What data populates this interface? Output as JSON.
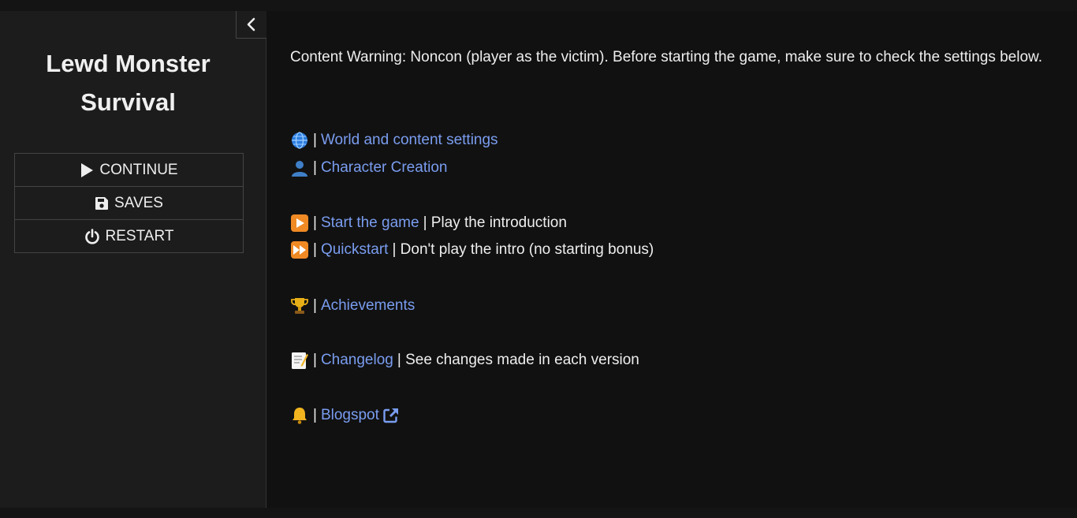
{
  "sidebar": {
    "title": "Lewd Monster Survival",
    "menu": [
      {
        "label": "CONTINUE",
        "icon": "play-icon"
      },
      {
        "label": "SAVES",
        "icon": "floppy-disk-icon"
      },
      {
        "label": "RESTART",
        "icon": "power-icon"
      }
    ],
    "stow_icon": "chevron-left-icon"
  },
  "passage": {
    "warning": "Content Warning: Noncon (player as the victim). Before starting the game, make sure to check the settings below.",
    "separator": "|",
    "links": {
      "world": {
        "icon": "globe-emoji-icon",
        "label": "World and content settings"
      },
      "character": {
        "icon": "bust-silhouette-emoji-icon",
        "label": "Character Creation"
      },
      "start": {
        "icon": "play-button-emoji-icon",
        "label": "Start the game",
        "desc": "| Play the introduction"
      },
      "quick": {
        "icon": "fast-forward-emoji-icon",
        "label": "Quickstart",
        "desc": "| Don't play the intro (no starting bonus)"
      },
      "achievements": {
        "icon": "trophy-emoji-icon",
        "label": "Achievements"
      },
      "changelog": {
        "icon": "memo-emoji-icon",
        "label": "Changelog",
        "desc": "| See changes made in each version"
      },
      "blogspot": {
        "icon": "bell-emoji-icon",
        "label": "Blogspot",
        "extra_icon": "external-link-icon"
      }
    }
  },
  "colors": {
    "background": "#111111",
    "sidebar": "#1c1c1c",
    "link": "#7a9df0",
    "text": "#eeeeee"
  }
}
